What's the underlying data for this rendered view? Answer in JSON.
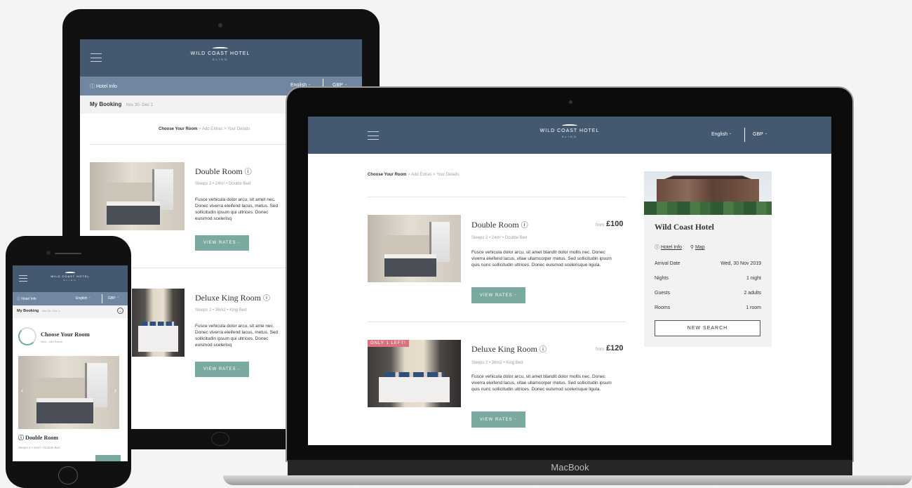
{
  "hotel": {
    "name": "WILD COAST HOTEL",
    "location": "SLIGO",
    "title": "Wild Coast Hotel"
  },
  "nav": {
    "hotel_info": "Hotel Info",
    "language": "English",
    "currency": "GBP",
    "map": "Map"
  },
  "booking": {
    "label": "My Booking",
    "dates": "Nov 30- Dec 1"
  },
  "steps": [
    "Choose Your Room",
    "Add Extras",
    "Your Details"
  ],
  "mobile_step": {
    "title": "Choose Your Room",
    "next": "Next : Add Extras"
  },
  "rooms": [
    {
      "name": "Double Room",
      "from": "from",
      "price": "£100",
      "sleeps": "Sleeps 2",
      "size": "24m²",
      "bed": "Double Bed",
      "desc": "Fusce vehicula dolor arcu, sit amet blandit dolor mollis nec. Donec viverra eleifend lacus, vitae ullamcorper metus. Sed sollicitudin ipsum quis nunc sollicitudin ultrices. Donec euismod scelerisque ligula.",
      "desc_tablet": "Fusce vehicula dolor arcu, sit amet nec. Donec viverra eleifend lacus, metus. Sed sollicitudin ipsum qui ultrices. Donec euismod scelerisq",
      "badge": "",
      "cta": "VIEW RATES"
    },
    {
      "name": "Deluxe King Room",
      "from": "from",
      "price": "£120",
      "sleeps": "Sleeps 2",
      "size": "36m2",
      "bed": "King Bed",
      "desc": "Fusce vehicula dolor arcu, sit amet blandit dolor mollis nec. Donec viverra eleifend lacus, vitae ullamcorper metus. Sed sollicitudin ipsum quis nunc sollicitudin ultrices. Donec euismod scelerisque ligula.",
      "desc_tablet": "Fusce vehicula dolor arcu, sit ame nec. Donec viverra eleifend lacus, metus. Sed sollicitudin ipsum qui ultrices. Donec euismod scelerisq",
      "badge": "ONLY 1 LEFT!",
      "cta": "VIEW RATES"
    }
  ],
  "summary": {
    "rows": [
      {
        "label": "Arrival Date",
        "value": "Wed, 30 Nov 2019"
      },
      {
        "label": "Nights",
        "value": "1 night"
      },
      {
        "label": "Guests",
        "value": "2 adults"
      },
      {
        "label": "Rooms",
        "value": "1 room"
      }
    ],
    "new_search": "NEW SEARCH"
  },
  "device": {
    "laptop_brand": "MacBook"
  },
  "colors": {
    "header": "#44596f",
    "accent": "#7aa99f",
    "badge": "#d9747f"
  }
}
